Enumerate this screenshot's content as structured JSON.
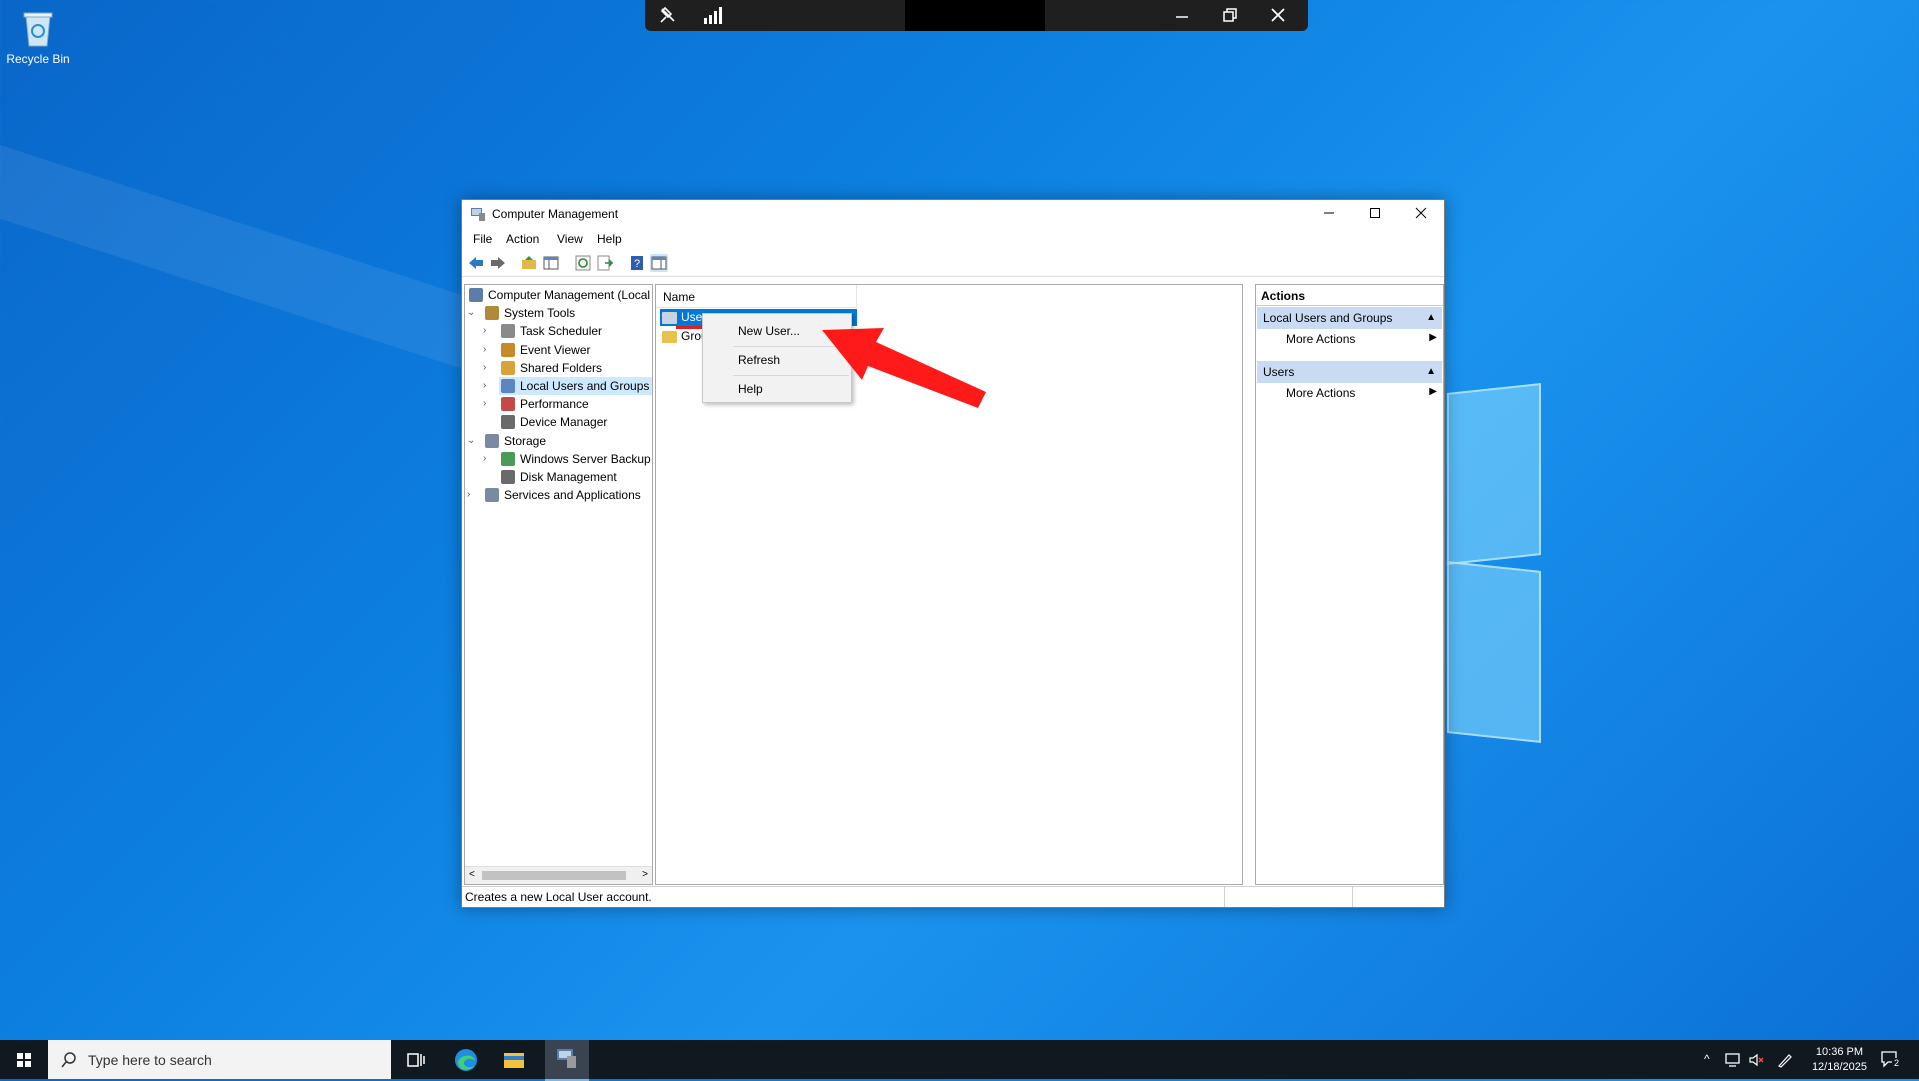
{
  "desktop": {
    "recycle_bin_label": "Recycle Bin"
  },
  "window": {
    "title": "Computer Management",
    "menu": [
      "File",
      "Action",
      "View",
      "Help"
    ]
  },
  "tree": {
    "items": [
      {
        "label": "Computer Management (Local",
        "level": 0,
        "expander": ""
      },
      {
        "label": "System Tools",
        "level": 1,
        "expander": "v"
      },
      {
        "label": "Task Scheduler",
        "level": 2,
        "expander": ">"
      },
      {
        "label": "Event Viewer",
        "level": 2,
        "expander": ">"
      },
      {
        "label": "Shared Folders",
        "level": 2,
        "expander": ">"
      },
      {
        "label": "Local Users and Groups",
        "level": 2,
        "expander": ">",
        "selected": true
      },
      {
        "label": "Performance",
        "level": 2,
        "expander": ">"
      },
      {
        "label": "Device Manager",
        "level": 2,
        "expander": ""
      },
      {
        "label": "Storage",
        "level": 1,
        "expander": "v"
      },
      {
        "label": "Windows Server Backup",
        "level": 2,
        "expander": ">"
      },
      {
        "label": "Disk Management",
        "level": 2,
        "expander": ""
      },
      {
        "label": "Services and Applications",
        "level": 1,
        "expander": ">"
      }
    ]
  },
  "list": {
    "column_header": "Name",
    "items": [
      "Users",
      "Grou"
    ]
  },
  "context_menu": {
    "items": [
      "New User...",
      "Refresh",
      "Help"
    ]
  },
  "actions": {
    "header": "Actions",
    "sections": [
      {
        "title": "Local Users and Groups",
        "action": "More Actions"
      },
      {
        "title": "Users",
        "action": "More Actions"
      }
    ]
  },
  "status_text": "Creates a new Local User account.",
  "taskbar": {
    "search_placeholder": "Type here to search",
    "time": "10:36 PM",
    "date": "12/18/2025",
    "notification_count": "2"
  },
  "colors": {
    "selection_blue": "#0078d7",
    "arrow_red": "#ff0000",
    "action_section_bg": "#c9dbf2"
  }
}
